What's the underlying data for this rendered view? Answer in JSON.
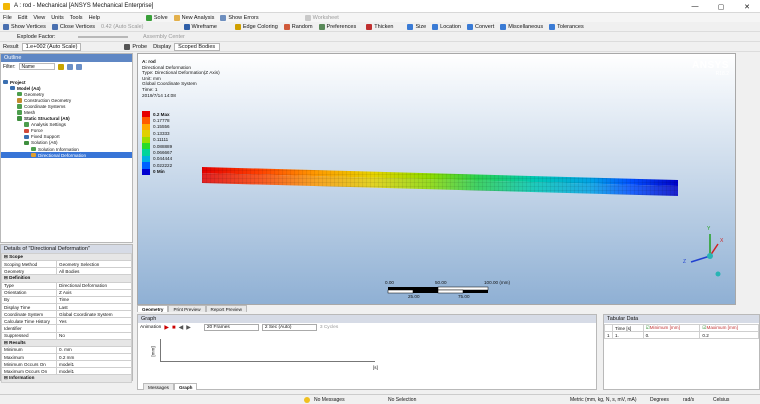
{
  "title": "A : rod - Mechanical [ANSYS Mechanical Enterprise]",
  "window_controls": [
    "—",
    "▢",
    "✕"
  ],
  "menu": [
    "File",
    "Edit",
    "View",
    "Units",
    "Tools",
    "Help"
  ],
  "toolbar1": [
    "Solve",
    "New Analysis",
    "Show Errors",
    "Worksheet"
  ],
  "toolbar2": [
    "Show Vertices",
    "Close Vertices",
    "0.42 (Auto Scale)",
    "Wireframe",
    "Edge Coloring",
    "Random",
    "Preferences",
    "Thicken",
    "Size",
    "Location",
    "Convert",
    "Miscellaneous",
    "Tolerances"
  ],
  "toolbar3": [
    "Explode Factor:",
    "Assembly Center"
  ],
  "toolbar4": [
    "Result",
    "1.e+002 (Auto Scale)",
    "Probe",
    "Display",
    "Scoped Bodies"
  ],
  "outline": {
    "title": "Outline",
    "filter_label": "Filter:",
    "filter_value": "Name",
    "items": [
      {
        "label": "Project",
        "indent": 0,
        "color": "#3a6fb0"
      },
      {
        "label": "Model (A4)",
        "indent": 1,
        "color": "#3a6fb0"
      },
      {
        "label": "Geometry",
        "indent": 2,
        "color": "#4d9e4d"
      },
      {
        "label": "Construction Geometry",
        "indent": 2,
        "color": "#c28a2e"
      },
      {
        "label": "Coordinate Systems",
        "indent": 2,
        "color": "#4d9e4d"
      },
      {
        "label": "Mesh",
        "indent": 2,
        "color": "#4d9e4d"
      },
      {
        "label": "Static Structural (A5)",
        "indent": 2,
        "color": "#3f8f3f"
      },
      {
        "label": "Analysis Settings",
        "indent": 3,
        "color": "#4d9e4d"
      },
      {
        "label": "Force",
        "indent": 3,
        "color": "#d24a3a"
      },
      {
        "label": "Fixed Support",
        "indent": 3,
        "color": "#3a6fb0"
      },
      {
        "label": "Solution (A6)",
        "indent": 3,
        "color": "#3f8f3f"
      },
      {
        "label": "Solution Information",
        "indent": 4,
        "color": "#4d9e4d"
      },
      {
        "label": "Directional Deformation",
        "indent": 4,
        "color": "#e0a030",
        "selected": true
      }
    ]
  },
  "details": {
    "title": "Details of \"Directional Deformation\"",
    "rows": [
      {
        "section": "Scope"
      },
      {
        "k": "Scoping Method",
        "v": "Geometry Selection"
      },
      {
        "k": "Geometry",
        "v": "All Bodies"
      },
      {
        "section": "Definition"
      },
      {
        "k": "Type",
        "v": "Directional Deformation"
      },
      {
        "k": "Orientation",
        "v": "Z Axis"
      },
      {
        "k": "By",
        "v": "Time"
      },
      {
        "k": "Display Time",
        "v": "Last"
      },
      {
        "k": "Coordinate System",
        "v": "Global Coordinate System"
      },
      {
        "k": "Calculate Time History",
        "v": "Yes"
      },
      {
        "k": "Identifier",
        "v": ""
      },
      {
        "k": "Suppressed",
        "v": "No"
      },
      {
        "section": "Results"
      },
      {
        "k": "Minimum",
        "v": "0. mm"
      },
      {
        "k": "Maximum",
        "v": "0.2 mm"
      },
      {
        "k": "Minimum Occurs On",
        "v": "model1"
      },
      {
        "k": "Maximum Occurs On",
        "v": "model1"
      },
      {
        "section": "Information"
      }
    ]
  },
  "viewport": {
    "info_lines": [
      "A: rod",
      "Directional Deformation",
      "Type: Directional Deformation(Z Axis)",
      "Unit: mm",
      "Global Coordinate System",
      "Time: 1",
      "2019/7/14 14:08"
    ],
    "brand": "ANSYS",
    "version": "R18.2",
    "legend": [
      "0.2 Max",
      "0.17778",
      "0.15556",
      "0.13333",
      "0.11111",
      "0.088889",
      "0.066667",
      "0.044444",
      "0.022222",
      "0 Min"
    ],
    "legend_colors": [
      "#e60000",
      "#ff5a00",
      "#ffa800",
      "#e0d000",
      "#9ade00",
      "#28dc28",
      "#00d49a",
      "#00b0e0",
      "#0060ff",
      "#0000d0"
    ],
    "scale_labels": [
      "0.00",
      "50.00",
      "100.00 (mm)",
      "25.00",
      "75.00"
    ],
    "axes": {
      "y": "Y",
      "z": "Z",
      "x": "X"
    }
  },
  "view_tabs": [
    "Geometry",
    "Print Preview",
    "Report Preview"
  ],
  "graph": {
    "title": "Graph",
    "animation_label": "Animation",
    "frames": "20 Frames",
    "duration": "2 Sec (Auto)",
    "cycles": "3 Cycles",
    "ylabel": "[mm]",
    "xlabel": "[s]",
    "tabs": [
      "Messages",
      "Graph"
    ]
  },
  "tabular": {
    "title": "Tabular Data",
    "headers": [
      "Time [s]",
      "Minimum [mm]",
      "Maximum [mm]"
    ],
    "rows": [
      [
        "1",
        "1.",
        "0.",
        "0.2"
      ]
    ]
  },
  "status": {
    "messages": "No Messages",
    "selection": "No Selection",
    "units": "Metric (mm, kg, N, s, mV, mA)",
    "angle": "Degrees",
    "rate": "rad/s",
    "temp": "Celsius"
  }
}
